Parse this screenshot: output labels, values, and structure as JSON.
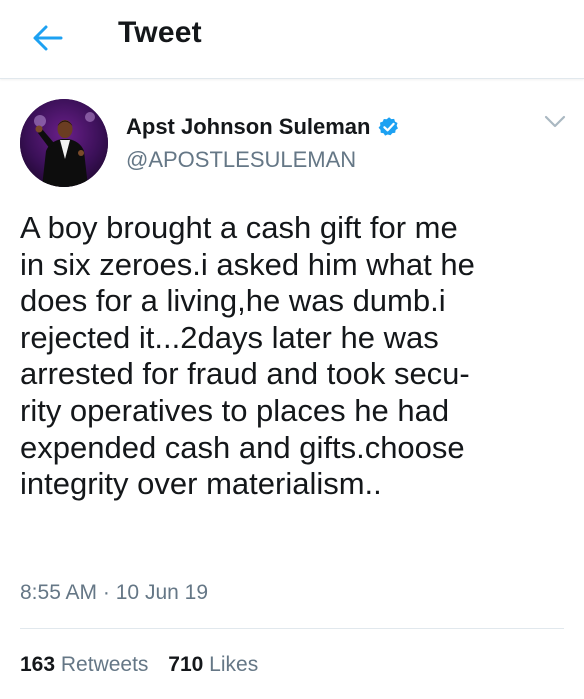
{
  "header": {
    "title": "Tweet",
    "back_icon": "arrow-left-icon"
  },
  "colors": {
    "accent": "#1da1f2",
    "text_primary": "#14171a",
    "text_secondary": "#657786",
    "divider": "#e1e8ed"
  },
  "tweet": {
    "author": {
      "name": "Apst Johnson Suleman",
      "handle": "@APOSTLESULEMAN",
      "verified_icon": "verified-badge-icon",
      "avatar_icon": "avatar-photo"
    },
    "menu_icon": "chevron-down-icon",
    "text": "A boy brought a cash gift for me\nin six zeroes.i asked him what he\ndoes for a living,he was dumb.i\nrejected it...2days later he was\narrested for  fraud and took secu-\nrity operatives to places he had\nexpended cash and gifts.choose\nintegrity over materialism..",
    "time": "8:55 AM",
    "separator": "·",
    "date": "10 Jun 19",
    "stats": {
      "retweets_count": "163",
      "retweets_label": "Retweets",
      "likes_count": "710",
      "likes_label": "Likes"
    }
  }
}
